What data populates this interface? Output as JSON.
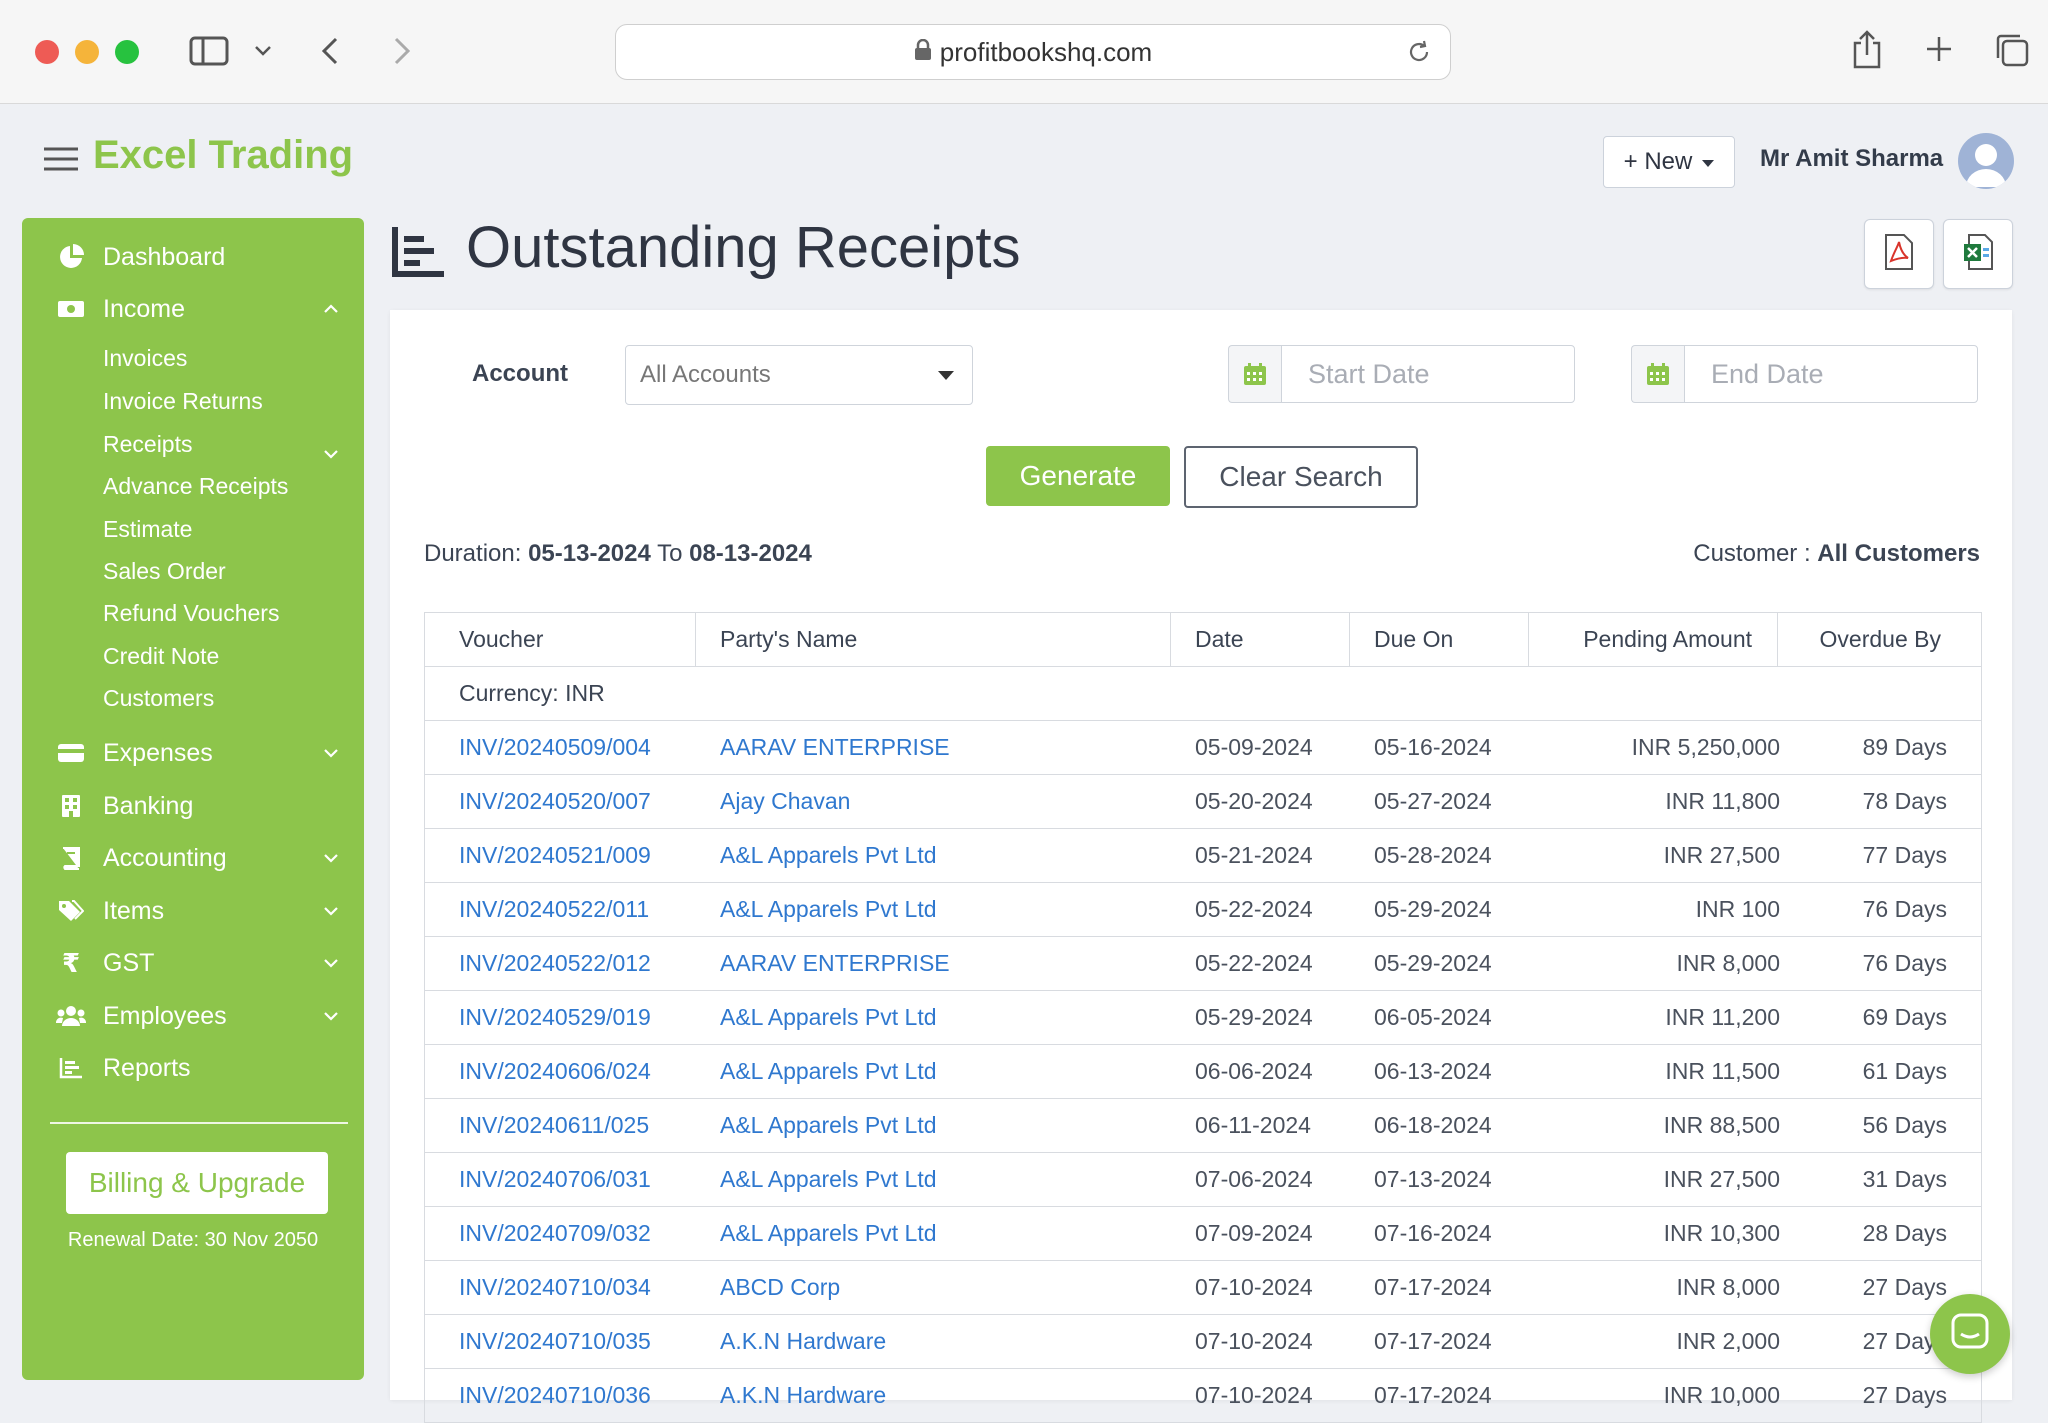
{
  "browser": {
    "url": "profitbookshq.com"
  },
  "header": {
    "app_title": "Excel Trading",
    "new_label": "+ New",
    "user_name": "Mr Amit Sharma"
  },
  "sidebar": {
    "items": [
      {
        "label": "Dashboard",
        "icon": "pie-chart-icon"
      },
      {
        "label": "Income",
        "icon": "money-icon"
      },
      {
        "label": "Expenses",
        "icon": "credit-card-icon"
      },
      {
        "label": "Banking",
        "icon": "building-icon"
      },
      {
        "label": "Accounting",
        "icon": "book-icon"
      },
      {
        "label": "Items",
        "icon": "tags-icon"
      },
      {
        "label": "GST",
        "icon": "rupee-icon"
      },
      {
        "label": "Employees",
        "icon": "users-icon"
      },
      {
        "label": "Reports",
        "icon": "bar-chart-icon"
      }
    ],
    "income_sub": [
      "Invoices",
      "Invoice Returns",
      "Receipts",
      "Advance Receipts",
      "Estimate",
      "Sales Order",
      "Refund Vouchers",
      "Credit Note",
      "Customers"
    ],
    "billing_label": "Billing & Upgrade",
    "renewal": "Renewal Date: 30 Nov 2050"
  },
  "page": {
    "title": "Outstanding Receipts"
  },
  "filters": {
    "account_label": "Account",
    "account_value": "All Accounts",
    "start_placeholder": "Start Date",
    "end_placeholder": "End Date",
    "generate_label": "Generate",
    "clear_label": "Clear Search"
  },
  "summary": {
    "duration_label": "Duration:",
    "start": "05-13-2024",
    "to": "To",
    "end": "08-13-2024",
    "customer_label": "Customer :",
    "customer_value": "All Customers"
  },
  "table": {
    "headers": [
      "Voucher",
      "Party's Name",
      "Date",
      "Due On",
      "Pending Amount",
      "Overdue By"
    ],
    "currency_row": "Currency: INR",
    "rows": [
      {
        "voucher": "INV/20240509/004",
        "party": "AARAV ENTERPRISE",
        "date": "05-09-2024",
        "due": "05-16-2024",
        "amount": "INR 5,250,000",
        "overdue": "89 Days"
      },
      {
        "voucher": "INV/20240520/007",
        "party": "Ajay Chavan",
        "date": "05-20-2024",
        "due": "05-27-2024",
        "amount": "INR 11,800",
        "overdue": "78 Days"
      },
      {
        "voucher": "INV/20240521/009",
        "party": "A&L Apparels Pvt Ltd",
        "date": "05-21-2024",
        "due": "05-28-2024",
        "amount": "INR 27,500",
        "overdue": "77 Days"
      },
      {
        "voucher": "INV/20240522/011",
        "party": "A&L Apparels Pvt Ltd",
        "date": "05-22-2024",
        "due": "05-29-2024",
        "amount": "INR 100",
        "overdue": "76 Days"
      },
      {
        "voucher": "INV/20240522/012",
        "party": "AARAV ENTERPRISE",
        "date": "05-22-2024",
        "due": "05-29-2024",
        "amount": "INR 8,000",
        "overdue": "76 Days"
      },
      {
        "voucher": "INV/20240529/019",
        "party": "A&L Apparels Pvt Ltd",
        "date": "05-29-2024",
        "due": "06-05-2024",
        "amount": "INR 11,200",
        "overdue": "69 Days"
      },
      {
        "voucher": "INV/20240606/024",
        "party": "A&L Apparels Pvt Ltd",
        "date": "06-06-2024",
        "due": "06-13-2024",
        "amount": "INR 11,500",
        "overdue": "61 Days"
      },
      {
        "voucher": "INV/20240611/025",
        "party": "A&L Apparels Pvt Ltd",
        "date": "06-11-2024",
        "due": "06-18-2024",
        "amount": "INR 88,500",
        "overdue": "56 Days"
      },
      {
        "voucher": "INV/20240706/031",
        "party": "A&L Apparels Pvt Ltd",
        "date": "07-06-2024",
        "due": "07-13-2024",
        "amount": "INR 27,500",
        "overdue": "31 Days"
      },
      {
        "voucher": "INV/20240709/032",
        "party": "A&L Apparels Pvt Ltd",
        "date": "07-09-2024",
        "due": "07-16-2024",
        "amount": "INR 10,300",
        "overdue": "28 Days"
      },
      {
        "voucher": "INV/20240710/034",
        "party": "ABCD Corp",
        "date": "07-10-2024",
        "due": "07-17-2024",
        "amount": "INR 8,000",
        "overdue": "27 Days"
      },
      {
        "voucher": "INV/20240710/035",
        "party": "A.K.N Hardware",
        "date": "07-10-2024",
        "due": "07-17-2024",
        "amount": "INR 2,000",
        "overdue": "27 Days"
      },
      {
        "voucher": "INV/20240710/036",
        "party": "A.K.N Hardware",
        "date": "07-10-2024",
        "due": "07-17-2024",
        "amount": "INR 10,000",
        "overdue": "27 Days"
      }
    ]
  },
  "colors": {
    "accent": "#8dc54b",
    "link": "#2f78cf"
  }
}
